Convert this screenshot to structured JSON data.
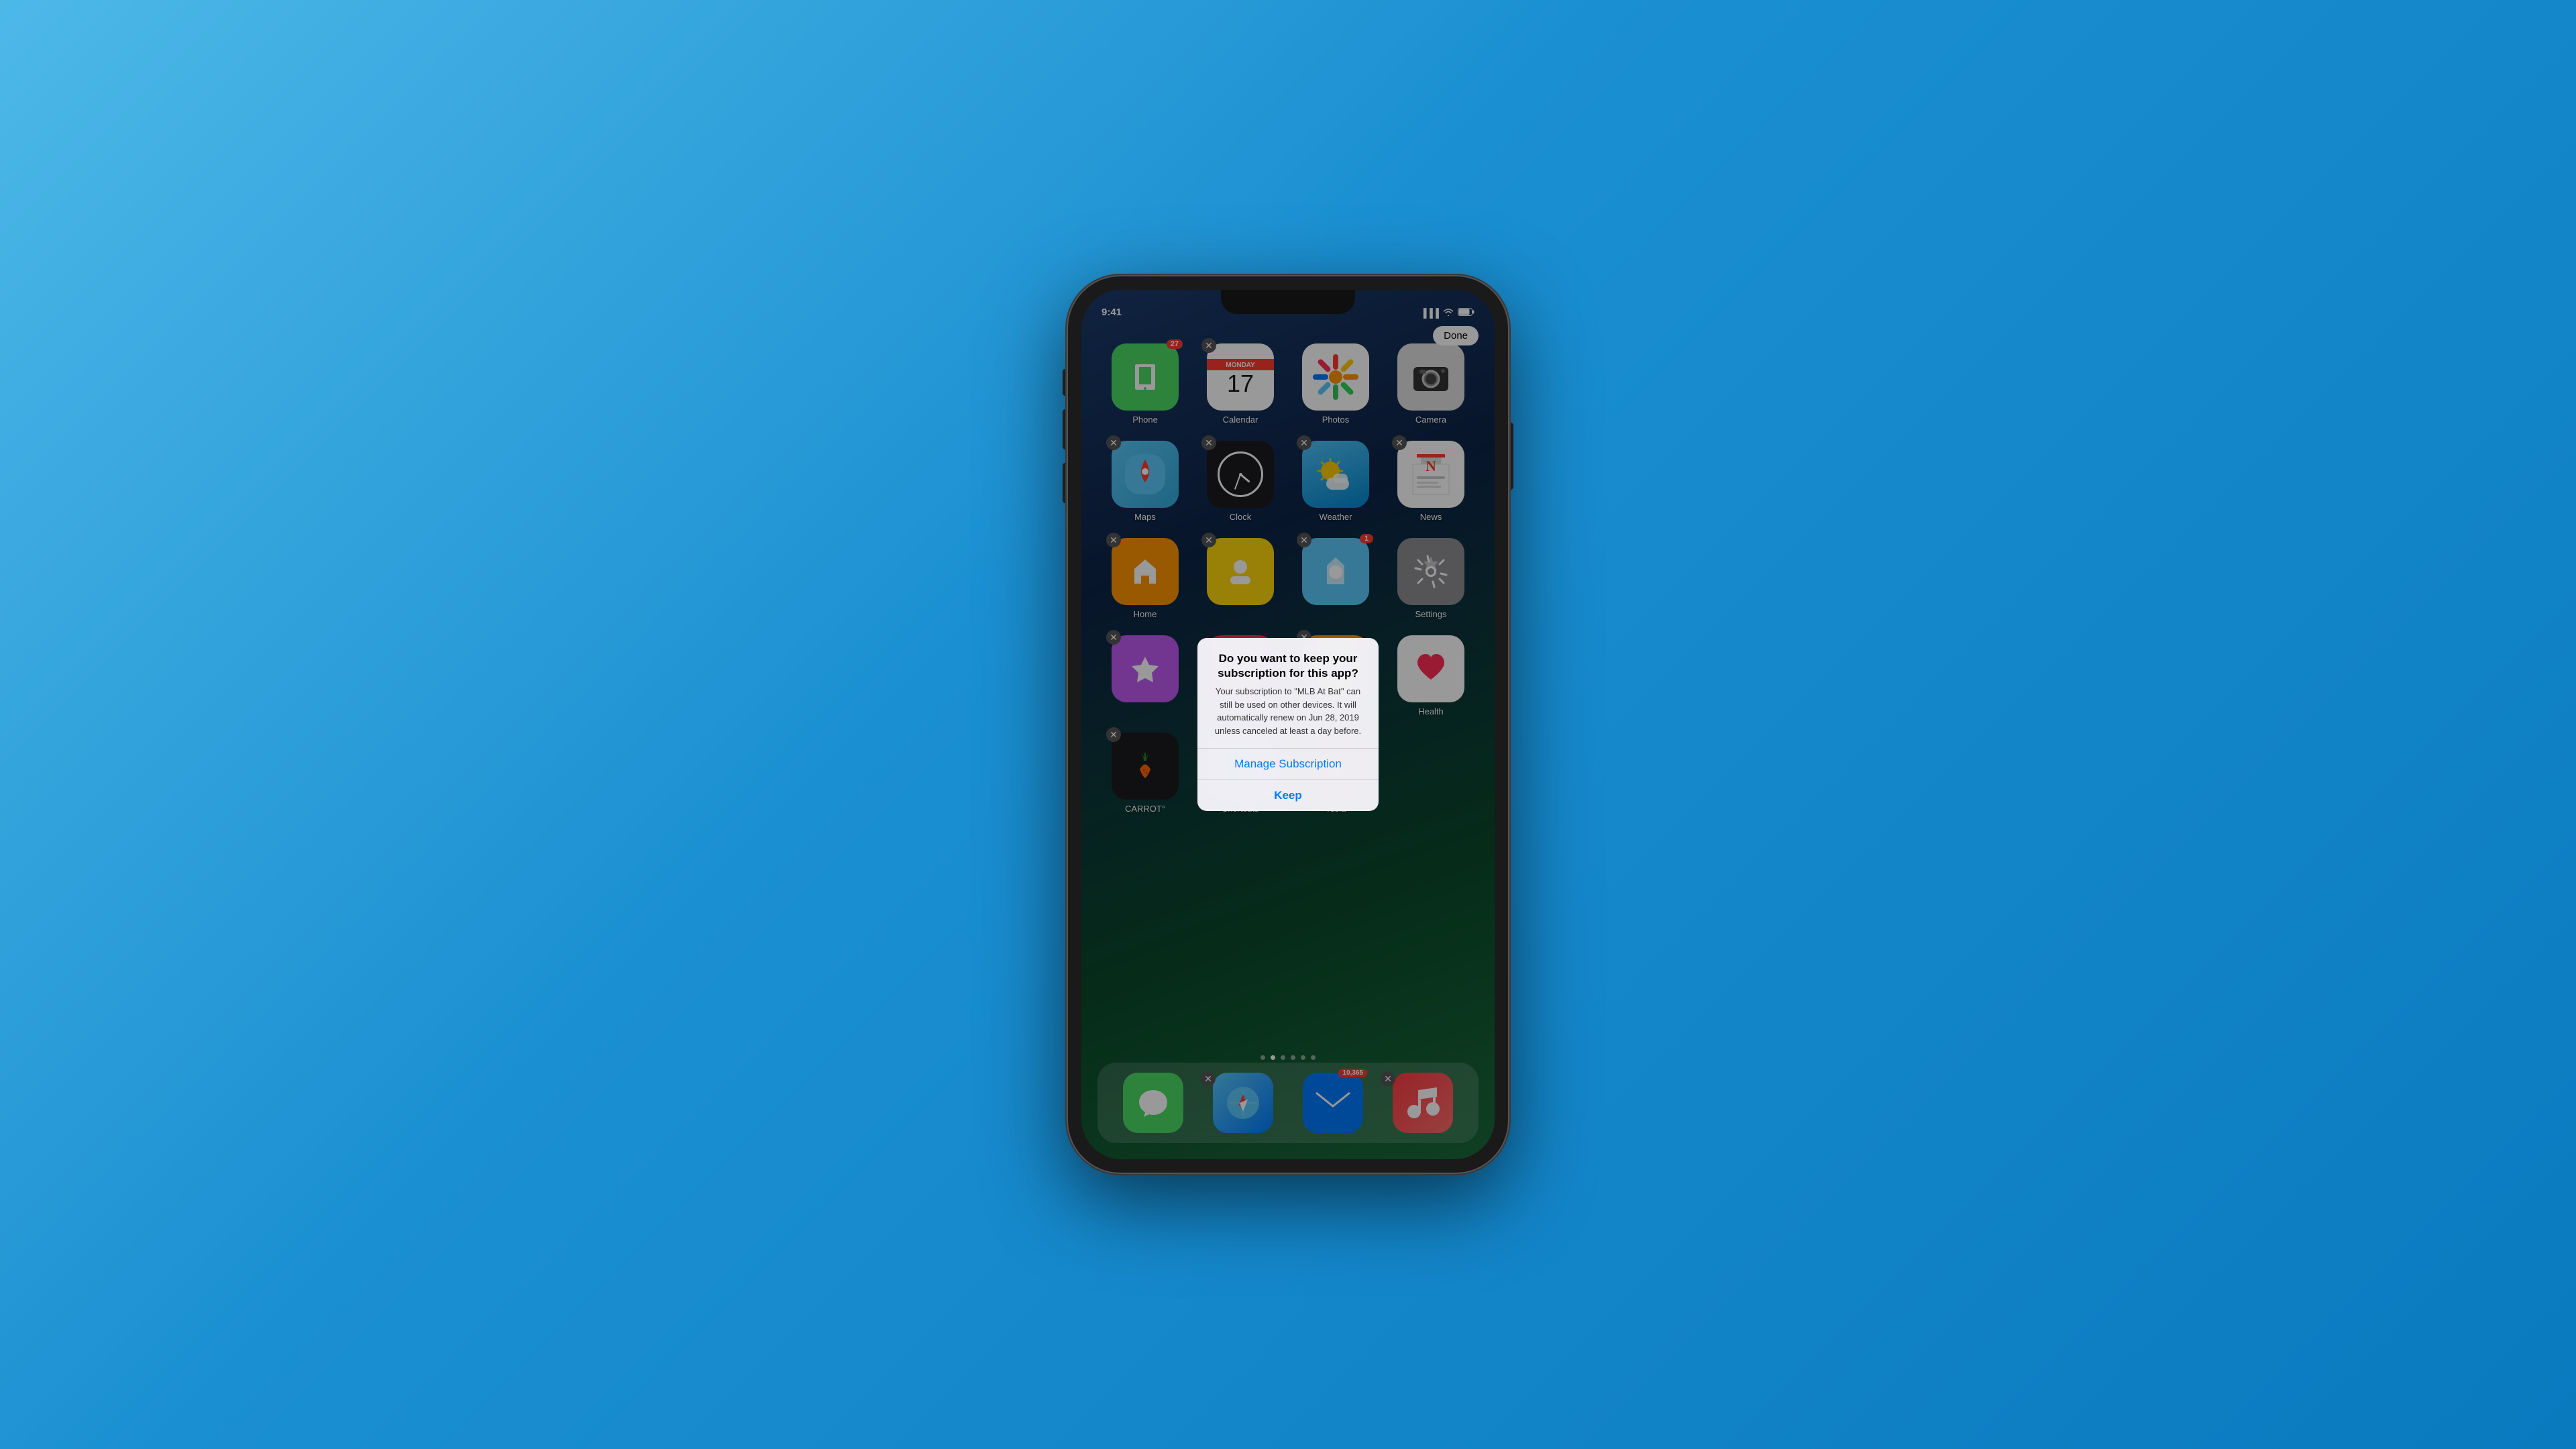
{
  "background": {
    "gradient_start": "#4db8e8",
    "gradient_end": "#0a7abf"
  },
  "status_bar": {
    "time": "9:41",
    "signal": "●●●",
    "wifi": "wifi",
    "battery": "battery"
  },
  "done_button": {
    "label": "Done"
  },
  "apps_row1": [
    {
      "name": "Phone",
      "label": "Phone",
      "has_delete": false,
      "badge": "27"
    },
    {
      "name": "Calendar",
      "label": "Calendar",
      "has_delete": true,
      "badge": null,
      "day": "Monday",
      "date": "17"
    },
    {
      "name": "Photos",
      "label": "Photos",
      "has_delete": false,
      "badge": null
    },
    {
      "name": "Camera",
      "label": "Camera",
      "has_delete": false,
      "badge": null
    }
  ],
  "apps_row2": [
    {
      "name": "Maps",
      "label": "Maps",
      "has_delete": true,
      "badge": null
    },
    {
      "name": "Clock",
      "label": "Clock",
      "has_delete": true,
      "badge": null
    },
    {
      "name": "Weather",
      "label": "Weather",
      "has_delete": true,
      "badge": null
    },
    {
      "name": "News",
      "label": "News",
      "has_delete": true,
      "badge": null
    }
  ],
  "apps_row3": [
    {
      "name": "Home",
      "label": "Home",
      "has_delete": true,
      "badge": null
    },
    {
      "name": "YellowApp",
      "label": "",
      "has_delete": true,
      "badge": null
    },
    {
      "name": "BlueApp",
      "label": "",
      "has_delete": true,
      "badge": "1"
    },
    {
      "name": "Settings",
      "label": "Settings",
      "has_delete": false,
      "badge": null
    }
  ],
  "apps_row4": [
    {
      "name": "Purple",
      "label": "",
      "has_delete": true,
      "badge": null
    },
    {
      "name": "Heart",
      "label": "",
      "has_delete": false,
      "badge": null
    },
    {
      "name": "Orange2",
      "label": "",
      "has_delete": true,
      "badge": null
    },
    {
      "name": "Health",
      "label": "Health",
      "has_delete": false,
      "badge": null
    }
  ],
  "apps_row5": [
    {
      "name": "CARROT",
      "label": "CARROT°",
      "has_delete": true,
      "badge": null
    },
    {
      "name": "Shortcuts",
      "label": "Shortcuts",
      "has_delete": true,
      "badge": null
    },
    {
      "name": "Tesla",
      "label": "Tesla",
      "has_delete": true,
      "badge": null
    },
    {
      "name": "Empty",
      "label": "",
      "has_delete": false,
      "badge": null
    }
  ],
  "dock": [
    {
      "name": "Messages",
      "label": "",
      "has_delete": false,
      "badge": null
    },
    {
      "name": "Safari",
      "label": "",
      "has_delete": true,
      "badge": null
    },
    {
      "name": "Mail",
      "label": "",
      "has_delete": false,
      "badge": "10,365"
    },
    {
      "name": "Music",
      "label": "",
      "has_delete": true,
      "badge": null
    }
  ],
  "page_dots": {
    "count": 6,
    "active": 1
  },
  "alert": {
    "title": "Do you want to keep your subscription for this app?",
    "message": "Your subscription to \"MLB At Bat\" can still be used on other devices. It will automatically renew on Jun 28, 2019 unless canceled at least a day before.",
    "button_manage": "Manage Subscription",
    "button_keep": "Keep"
  }
}
